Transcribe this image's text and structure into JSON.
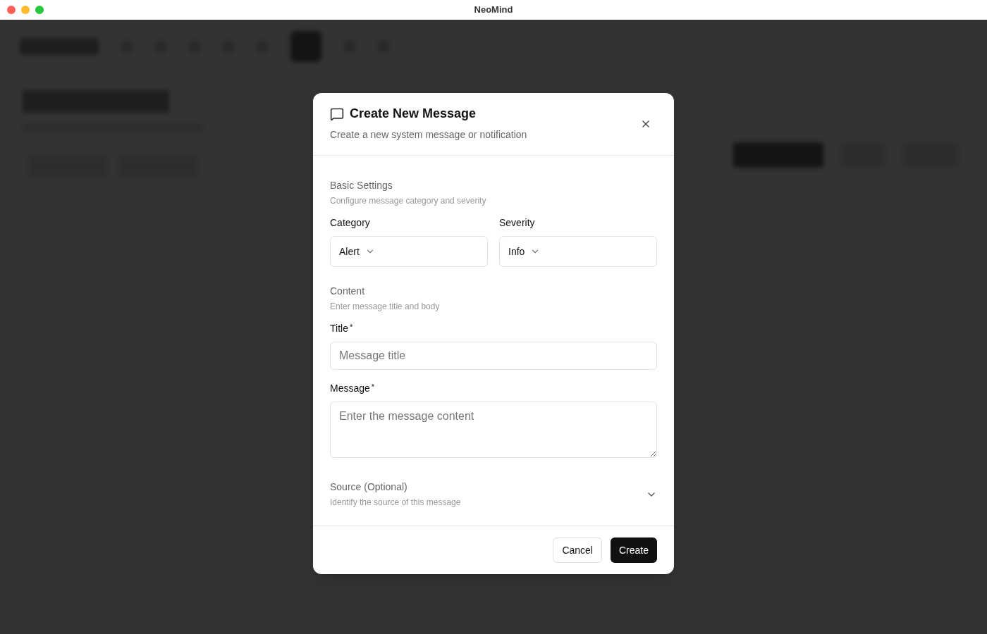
{
  "window": {
    "title": "NeoMind"
  },
  "dialog": {
    "title": "Create New Message",
    "subtitle": "Create a new system message or notification",
    "sections": [
      {
        "kind": "selects",
        "title": "Basic Settings",
        "description": "Configure message category and severity",
        "fields": [
          {
            "label": "Category",
            "value": "Alert"
          },
          {
            "label": "Severity",
            "value": "Info"
          }
        ]
      },
      {
        "kind": "inputs",
        "title": "Content",
        "description": "Enter message title and body",
        "fields": [
          {
            "kind": "input",
            "label": "Title",
            "required_mark": "*",
            "placeholder": "Message title"
          },
          {
            "kind": "textarea",
            "label": "Message",
            "required_mark": "*",
            "placeholder": "Enter the message content"
          }
        ]
      },
      {
        "kind": "collapsible",
        "title": "Source (Optional)",
        "description": "Identify the source of this message",
        "expanded": false
      }
    ],
    "buttons": [
      {
        "label": "Cancel",
        "primary": false
      },
      {
        "label": "Create",
        "primary": true
      }
    ]
  }
}
